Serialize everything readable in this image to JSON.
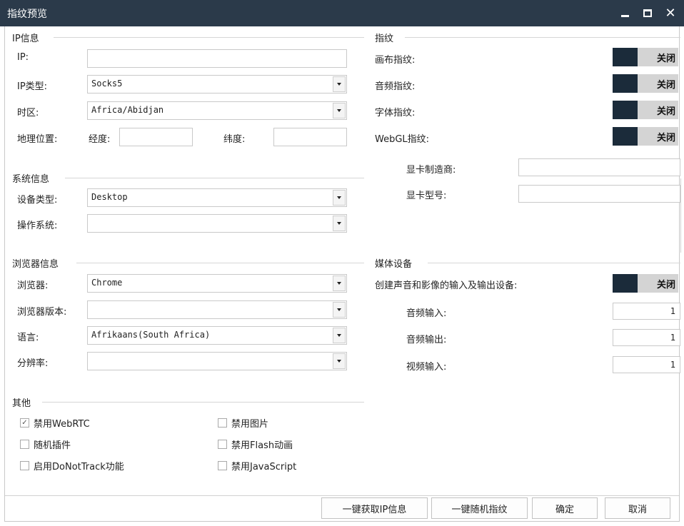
{
  "window": {
    "title": "指纹预览"
  },
  "ip_section": {
    "title": "IP信息",
    "ip_label": "IP:",
    "ip_value": "",
    "type_label": "IP类型:",
    "type_value": "Socks5",
    "tz_label": "时区:",
    "tz_value": "Africa/Abidjan",
    "geo_label": "地理位置:",
    "lon_label": "经度:",
    "lon_value": "",
    "lat_label": "纬度:",
    "lat_value": ""
  },
  "system_section": {
    "title": "系统信息",
    "device_label": "设备类型:",
    "device_value": "Desktop",
    "os_label": "操作系统:",
    "os_value": ""
  },
  "browser_section": {
    "title": "浏览器信息",
    "browser_label": "浏览器:",
    "browser_value": "Chrome",
    "version_label": "浏览器版本:",
    "version_value": "",
    "lang_label": "语言:",
    "lang_value": "Afrikaans(South Africa)",
    "res_label": "分辨率:",
    "res_value": ""
  },
  "fingerprint_section": {
    "title": "指纹",
    "canvas_label": "画布指纹:",
    "canvas_state": "关闭",
    "audio_label": "音频指纹:",
    "audio_state": "关闭",
    "font_label": "字体指纹:",
    "font_state": "关闭",
    "webgl_label": "WebGL指纹:",
    "webgl_state": "关闭",
    "vendor_label": "显卡制造商:",
    "vendor_value": "",
    "model_label": "显卡型号:",
    "model_value": ""
  },
  "media_section": {
    "title": "媒体设备",
    "create_label": "创建声音和影像的输入及输出设备:",
    "create_state": "关闭",
    "audio_in_label": "音频输入:",
    "audio_in_value": "1",
    "audio_out_label": "音频输出:",
    "audio_out_value": "1",
    "video_in_label": "视频输入:",
    "video_in_value": "1"
  },
  "other_section": {
    "title": "其他",
    "webrtc": {
      "label": "禁用WebRTC",
      "checked": true
    },
    "random_plugins": {
      "label": "随机插件",
      "checked": false
    },
    "dnt": {
      "label": "启用DoNotTrack功能",
      "checked": false
    },
    "no_images": {
      "label": "禁用图片",
      "checked": false
    },
    "no_flash": {
      "label": "禁用Flash动画",
      "checked": false
    },
    "no_js": {
      "label": "禁用JavaScript",
      "checked": false
    }
  },
  "buttons": {
    "get_ip": "一键获取IP信息",
    "random_fp": "一键随机指纹",
    "ok": "确定",
    "cancel": "取消"
  },
  "colors": {
    "titlebar": "#2b3a4a",
    "toggle_dark": "#1b2b3a",
    "toggle_light": "#d4d4d4"
  }
}
